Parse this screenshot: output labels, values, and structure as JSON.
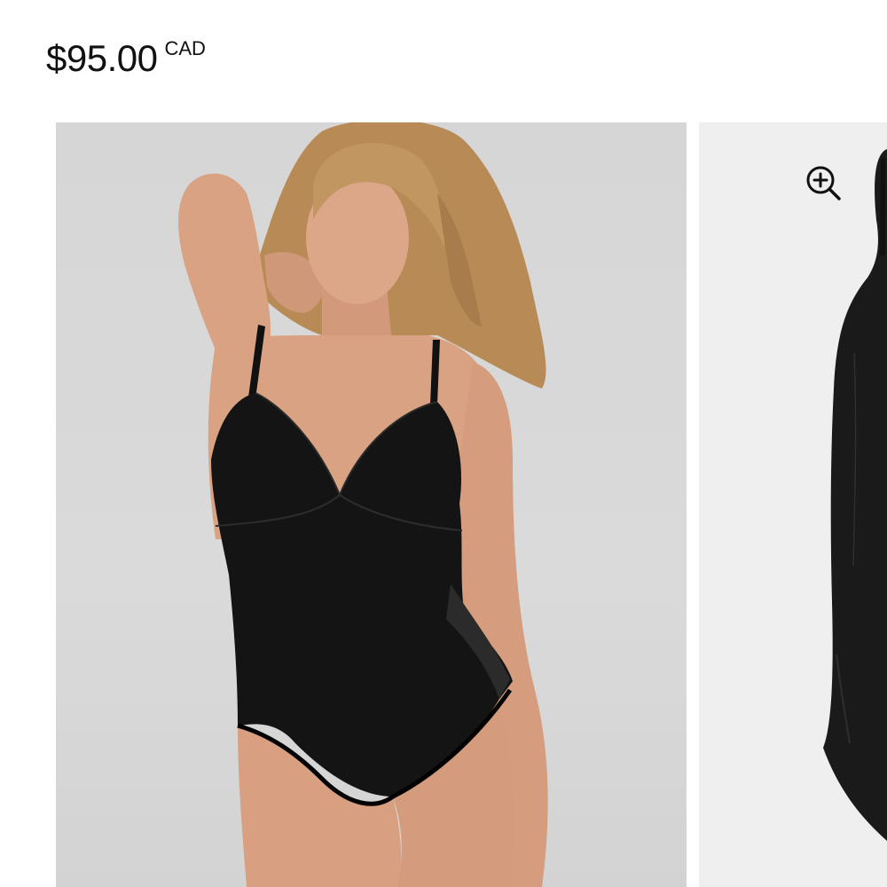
{
  "product": {
    "price": "$95.00",
    "currency": "CAD"
  },
  "gallery": {
    "zoom_icon": "zoom-in-icon",
    "colors": {
      "backdrop_main": "#d7d7d7",
      "backdrop_secondary": "#efefef",
      "garment": "#111111",
      "skin": "#d9a383",
      "hair": "#b88a55"
    }
  }
}
